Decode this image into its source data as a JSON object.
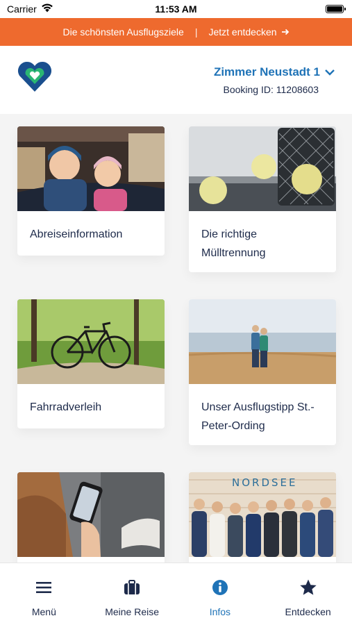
{
  "status_bar": {
    "carrier": "Carrier",
    "time": "11:53 AM"
  },
  "promo": {
    "text": "Die schönsten Ausflugsziele",
    "separator": "|",
    "link": "Jetzt entdecken"
  },
  "header": {
    "room": "Zimmer Neustadt 1",
    "booking": "Booking ID: 11208603"
  },
  "cards": [
    {
      "title": "Abreiseinformation",
      "image": "kids-in-car-trunk"
    },
    {
      "title": "Die richtige Mülltrennung",
      "image": "waste-bin-paper-balls"
    },
    {
      "title": "Fahrradverleih",
      "image": "bicycle-forest-path"
    },
    {
      "title": "Unser Ausflugstipp St.-Peter-Ording",
      "image": "couple-on-beach"
    },
    {
      "title": "",
      "image": "hand-holding-phone"
    },
    {
      "title": "",
      "image": "team-photo-nordsee",
      "image_text": "NORDSEE"
    }
  ],
  "tabs": [
    {
      "label": "Menü",
      "icon": "menu-icon"
    },
    {
      "label": "Meine Reise",
      "icon": "suitcase-icon"
    },
    {
      "label": "Infos",
      "icon": "info-icon",
      "active": true
    },
    {
      "label": "Entdecken",
      "icon": "star-icon"
    }
  ],
  "colors": {
    "accent": "#1f73b7",
    "promo": "#ee6a2e",
    "logo": "#1a4f8e",
    "logo_inner": "#2bb673",
    "text": "#1d2a4a"
  }
}
